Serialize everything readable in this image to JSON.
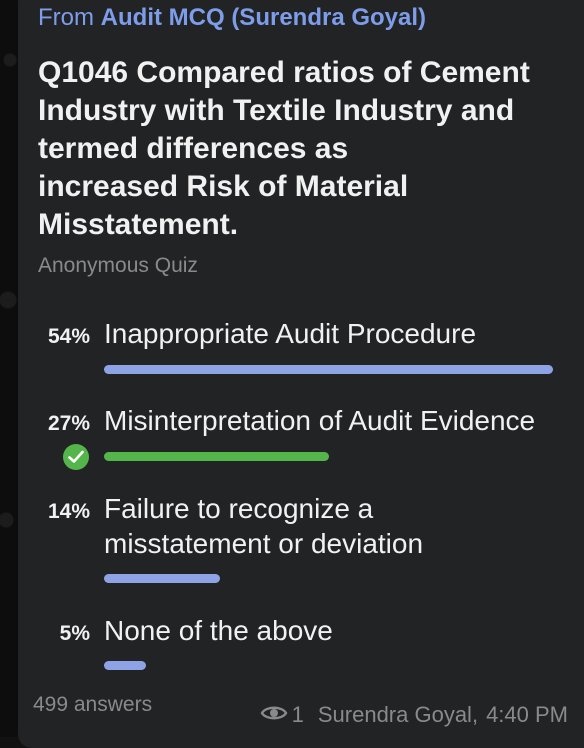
{
  "message": {
    "forwarded_prefix": "From",
    "forwarded_source": "Audit MCQ (Surendra Goyal)",
    "question": "Q1046 Compared ratios of Cement\nIndustry with Textile Industry and\ntermed differences as\nincreased Risk of Material\nMisstatement.",
    "quiz_type": "Anonymous Quiz",
    "options": [
      {
        "percent": "54%",
        "label": "Inappropriate Audit Procedure",
        "share": 0.54,
        "correct": false
      },
      {
        "percent": "27%",
        "label": "Misinterpretation of Audit Evidence",
        "share": 0.27,
        "correct": true
      },
      {
        "percent": "14%",
        "label": "Failure to recognize a misstatement or deviation",
        "share": 0.14,
        "correct": false
      },
      {
        "percent": "5%",
        "label": "None of the above",
        "share": 0.05,
        "correct": false
      }
    ],
    "answers_count": "499 answers",
    "views": "1",
    "author": "Surendra Goyal,",
    "time": "4:40 PM",
    "colors": {
      "bar": "#8ea3e6",
      "correct": "#54b64a",
      "link": "#7d9dea"
    }
  }
}
